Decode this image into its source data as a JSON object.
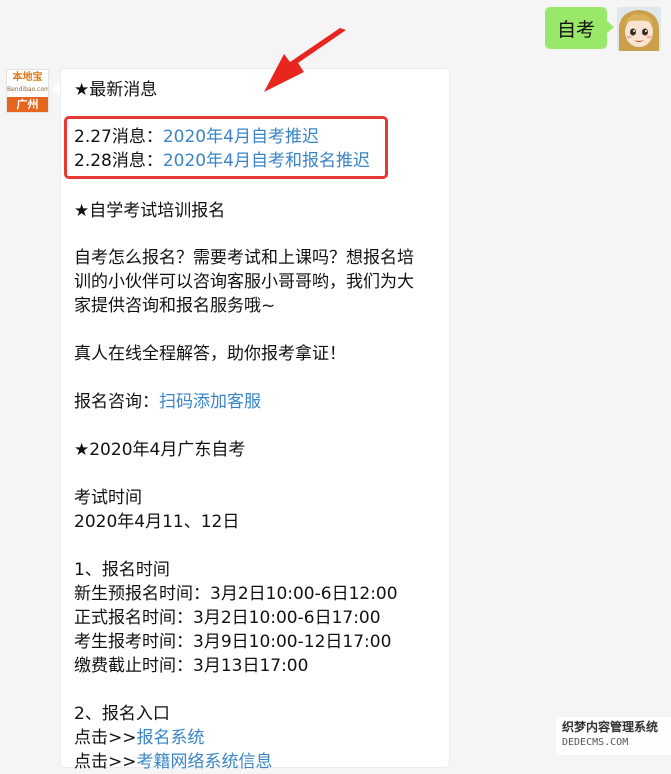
{
  "user_message": {
    "text": "自考"
  },
  "bot_avatar": {
    "logo_top": "本地宝",
    "logo_sub": "Bendibao.com",
    "city": "广州"
  },
  "bot_message": {
    "latest_heading": "★最新消息",
    "news": [
      {
        "prefix": "2.27消息：",
        "link": "2020年4月自考推迟"
      },
      {
        "prefix": "2.28消息：",
        "link": "2020年4月自考和报名推迟"
      }
    ],
    "training_heading": "★自学考试培训报名",
    "training_para": [
      "自考怎么报名？需要考试和上课吗？想报名培",
      "训的小伙伴可以咨询客服小哥哥哟，我们为大",
      "家提供咨询和报名服务哦~"
    ],
    "answer_line": "真人在线全程解答，助你报考拿证！",
    "consult_prefix": "报名咨询：",
    "consult_link": "扫码添加客服",
    "gd_heading": "★2020年4月广东自考",
    "exam_time_label": "考试时间",
    "exam_time_value": "2020年4月11、12日",
    "section1_title": "1、报名时间",
    "schedule": [
      "新生预报名时间：3月2日10:00-6日12:00",
      "正式报名时间：3月2日10:00-6日17:00",
      "考生报考时间：3月9日10:00-12日17:00",
      "缴费截止时间：3月13日17:00"
    ],
    "section2_title": "2、报名入口",
    "entry_prefix": "点击>>",
    "entry_link": "报名系统",
    "entry2_prefix": "点击>>",
    "entry2_link": "考籍网络系统信息"
  },
  "watermark": {
    "cn": "织梦内容管理系统",
    "en": "DEDECMS.COM"
  },
  "colors": {
    "link": "#3a85c7",
    "highlight": "#e53935",
    "user_bubble": "#9ae86a",
    "background": "#f5f5f5"
  }
}
